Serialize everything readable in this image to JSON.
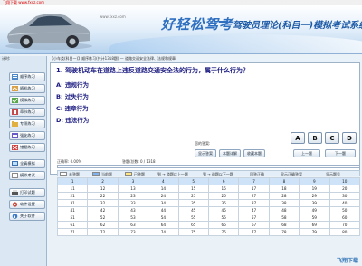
{
  "window": {
    "title": "飞翔下载 www.fxxz.com"
  },
  "banner": {
    "brand": "好轻松驾考",
    "system_title": "驾驶员理论(科目一)模拟考试系统",
    "url": "www.fxxz.com"
  },
  "sidebar": {
    "header": "计时:",
    "items": [
      {
        "label": "顺序练习",
        "icon": "list-icon"
      },
      {
        "label": "随机练习",
        "icon": "shuffle-icon"
      },
      {
        "label": "模拟练习",
        "icon": "exam-icon"
      },
      {
        "label": "章节练习",
        "icon": "chapter-icon"
      },
      {
        "label": "专项练习",
        "icon": "folder-icon"
      },
      {
        "label": "强化练习",
        "icon": "strength-icon"
      },
      {
        "label": "错题练习",
        "icon": "mistake-icon"
      },
      {
        "label": "全真模拟",
        "icon": "monitor-icon"
      },
      {
        "label": "模拟考试",
        "icon": "test-icon"
      },
      {
        "label": "打印试题",
        "icon": "print-icon"
      },
      {
        "label": "软件设置",
        "icon": "settings-icon"
      },
      {
        "label": "关于软件",
        "icon": "info-icon"
      }
    ]
  },
  "breadcrumb": "【小车类(科目一)】顺序练习(共计1318题)  —  道路交通安全法律、法规和规章",
  "question": {
    "text": "1. 驾驶机动车在道路上违反道路交通安全法的行为，属于什么行为？",
    "options": [
      {
        "key": "A",
        "text": "A: 违规行为"
      },
      {
        "key": "B",
        "text": "B: 过失行为"
      },
      {
        "key": "C",
        "text": "C: 违章行为"
      },
      {
        "key": "D",
        "text": "D: 违法行为"
      }
    ]
  },
  "controls": {
    "your_answer_label": "您的答案:",
    "accuracy_label": "正确率: 0.00%",
    "count_label": "答题/总数: 0 / 1318",
    "answer_buttons": [
      "A",
      "B",
      "C",
      "D"
    ],
    "buttons": {
      "show_answer": "显示答案",
      "explain": "本题详解",
      "fav": "收藏本题",
      "prev": "上一题",
      "next": "下一题"
    }
  },
  "legend": {
    "items": [
      "未答题",
      "当前题",
      "已答题",
      "到 → 道题以上一题",
      "到 → 道题以下一题",
      "回答正确",
      "显示正确答案",
      "显示题号"
    ],
    "sw_colors": [
      "#ffffff",
      "#7fb3f0",
      "#ffe680"
    ]
  },
  "grid": {
    "rows": [
      [
        "1",
        "2",
        "3",
        "4",
        "5",
        "6",
        "7",
        "8",
        "9",
        "10"
      ],
      [
        "11",
        "12",
        "13",
        "14",
        "15",
        "16",
        "17",
        "18",
        "19",
        "20"
      ],
      [
        "21",
        "22",
        "23",
        "24",
        "25",
        "26",
        "27",
        "28",
        "29",
        "30"
      ],
      [
        "31",
        "32",
        "33",
        "34",
        "35",
        "36",
        "37",
        "38",
        "39",
        "40"
      ],
      [
        "41",
        "42",
        "43",
        "44",
        "45",
        "46",
        "47",
        "48",
        "49",
        "50"
      ],
      [
        "51",
        "52",
        "53",
        "54",
        "55",
        "56",
        "57",
        "58",
        "59",
        "60"
      ],
      [
        "61",
        "62",
        "63",
        "64",
        "65",
        "66",
        "67",
        "68",
        "69",
        "70"
      ],
      [
        "71",
        "72",
        "73",
        "74",
        "75",
        "76",
        "77",
        "78",
        "79",
        "80"
      ]
    ]
  },
  "watermark": "飞翔下载"
}
